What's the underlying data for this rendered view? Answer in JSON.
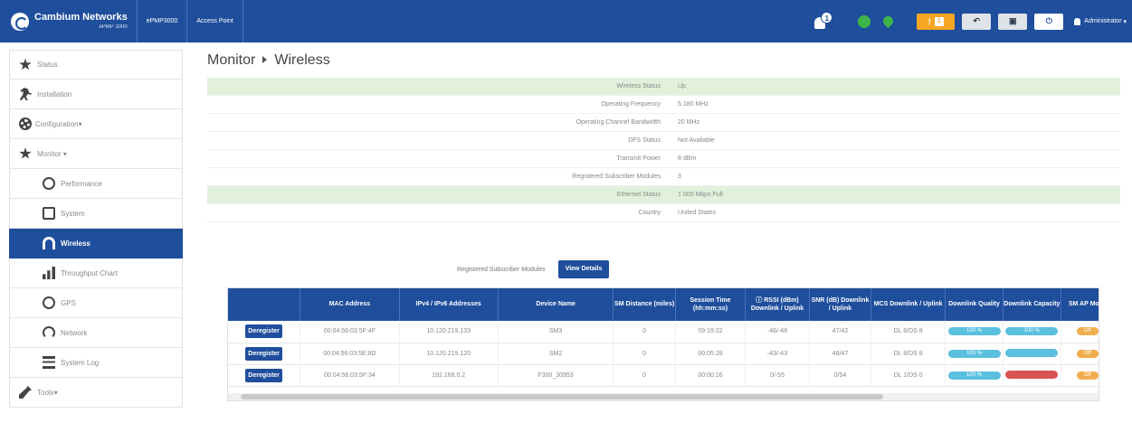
{
  "topbar": {
    "brand_name": "Cambium Networks",
    "brand_model": "ePMP 3000",
    "device": "ePMP3000",
    "mode": "Access Point",
    "alarm_count": "1",
    "pending_count": "1",
    "user": "Administrator"
  },
  "sidebar": {
    "items": [
      {
        "label": "Status",
        "icon": "star-icon"
      },
      {
        "label": "Installation",
        "icon": "runner-icon"
      },
      {
        "label": "Configuration",
        "icon": "gear-icon"
      },
      {
        "label": "Monitor",
        "icon": "star-icon"
      },
      {
        "label": "Performance",
        "icon": "gauge-icon"
      },
      {
        "label": "System",
        "icon": "system-icon"
      },
      {
        "label": "Wireless",
        "icon": "wifi-icon"
      },
      {
        "label": "Throughput Chart",
        "icon": "bar-chart-icon"
      },
      {
        "label": "GPS",
        "icon": "globe-icon"
      },
      {
        "label": "Network",
        "icon": "network-icon"
      },
      {
        "label": "System Log",
        "icon": "log-icon"
      },
      {
        "label": "Tools",
        "icon": "wrench-icon"
      }
    ]
  },
  "page": {
    "title": "Monitor",
    "subtitle": "Wireless"
  },
  "info": [
    {
      "key": "Wireless Status",
      "value": "Up"
    },
    {
      "key": "Operating Frequency",
      "value": "5.180 MHz"
    },
    {
      "key": "Operating Channel Bandwidth",
      "value": "20 MHz"
    },
    {
      "key": "DFS Status",
      "value": "Not Available"
    },
    {
      "key": "Transmit Power",
      "value": "8 dBm"
    },
    {
      "key": "Registered Subscriber Modules",
      "value": "3"
    },
    {
      "key": "Ethernet Status",
      "value": "1 000 Mbps Full"
    },
    {
      "key": "Country",
      "value": "United States"
    }
  ],
  "registered": {
    "label": "Registered Subscriber Modules",
    "button": "View Details"
  },
  "table": {
    "headers": [
      "",
      "MAC Address",
      "IPv4 / IPv6 Addresses",
      "Device Name",
      "SM Distance (miles)",
      "Session Time (hh:mm:ss)",
      "RSSI (dBm) Downlink / Uplink",
      "SNR (dB) Downlink / Uplink",
      "MCS Downlink / Uplink",
      "Downlink Quality",
      "Downlink Capacity",
      "SM AP Mode"
    ],
    "action_label": "Deregister",
    "rows": [
      {
        "mac": "00:04:56:03:5F:4F",
        "ip": "10.120.219.133",
        "name": "SM3",
        "dist": "0",
        "time": "09:19:22",
        "rssi": "-46/-48",
        "snr": "47/42",
        "mcs": "DL 8/DS 8",
        "quality": "100 %",
        "capacity": "100 %",
        "mode": "Off"
      },
      {
        "mac": "00:04:56:03:5E:8D",
        "ip": "10.120.219.120",
        "name": "SM2",
        "dist": "0",
        "time": "00:05:28",
        "rssi": "-43/-43",
        "snr": "48/47",
        "mcs": "DL 8/DS 8",
        "quality": "100 %",
        "capacity": "",
        "mode": "Off"
      },
      {
        "mac": "00:04:56:03:5F:34",
        "ip": "192.168.0.2",
        "name": "F300_30953",
        "dist": "0",
        "time": "00:00:16",
        "rssi": "0/-55",
        "snr": "0/54",
        "mcs": "DL 1/DS 0",
        "quality": "100 %",
        "capacity": "",
        "mode": "Off"
      }
    ]
  },
  "colors": {
    "brand": "#1f4e9c",
    "status_green": "#e2f1dc",
    "pill_blue": "#5bc0de",
    "pill_red": "#d9534f",
    "pill_orange": "#f0ad4e"
  }
}
